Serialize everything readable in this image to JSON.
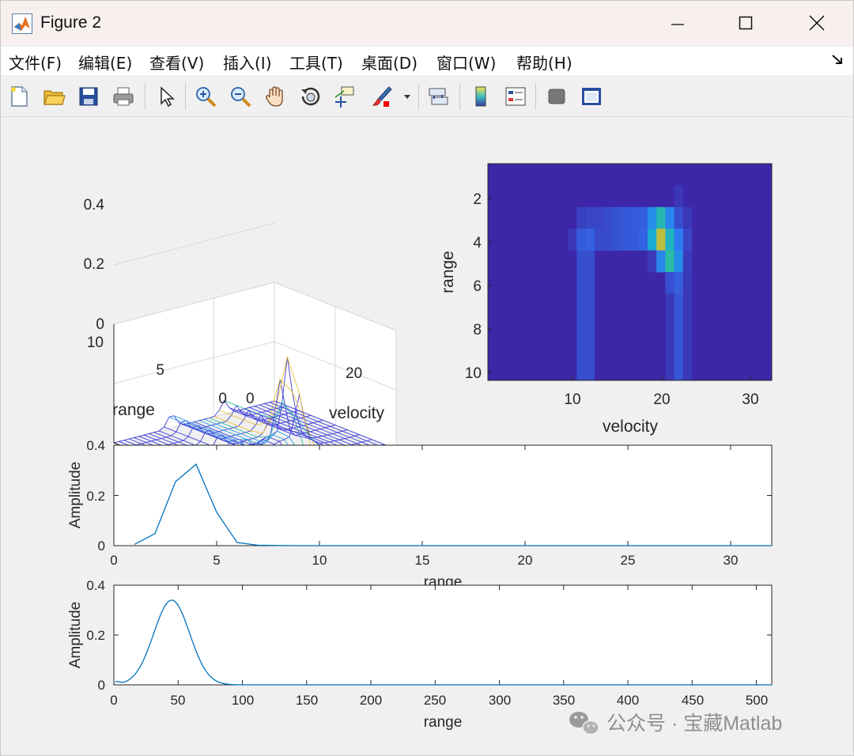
{
  "window": {
    "title": "Figure 2"
  },
  "menu": [
    "文件(F)",
    "编辑(E)",
    "查看(V)",
    "插入(I)",
    "工具(T)",
    "桌面(D)",
    "窗口(W)",
    "帮助(H)"
  ],
  "toolbar_icons": [
    "new-figure-icon",
    "open-file-icon",
    "save-icon",
    "print-icon",
    "pointer-icon",
    "zoom-in-icon",
    "zoom-out-icon",
    "pan-icon",
    "rotate-3d-icon",
    "data-cursor-icon",
    "brush-icon",
    "brush-dropdown-icon",
    "link-plot-icon",
    "colorbar-icon",
    "legend-icon",
    "hide-plot-tools-icon",
    "show-plot-tools-icon"
  ],
  "watermark": "公众号 · 宝藏Matlab",
  "chart_data": [
    {
      "type": "surface",
      "xlabel": "velocity",
      "ylabel": "range",
      "x_ticks": [
        "0",
        "20"
      ],
      "y_ticks": [
        "0",
        "5",
        "10"
      ],
      "z_ticks": [
        "0",
        "0.2",
        "0.4"
      ],
      "xlim": [
        0,
        32
      ],
      "ylim": [
        0,
        10
      ],
      "zlim": [
        0,
        0.4
      ],
      "peak": {
        "velocity": 20,
        "range": 4,
        "amplitude": 0.29
      },
      "grid": true
    },
    {
      "type": "heatmap",
      "xlabel": "velocity",
      "ylabel": "range",
      "x_ticks": [
        "10",
        "20",
        "30"
      ],
      "y_ticks": [
        "2",
        "4",
        "6",
        "8",
        "10"
      ],
      "xlim": [
        0.5,
        32.5
      ],
      "ylim": [
        0.5,
        10.5
      ],
      "colormap": "parula",
      "bright_cells": [
        [
          20,
          3
        ],
        [
          20,
          4
        ],
        [
          21,
          5
        ],
        [
          19,
          3
        ],
        [
          19,
          4
        ],
        [
          17,
          4
        ],
        [
          16,
          4
        ],
        [
          15,
          4
        ],
        [
          21,
          4
        ],
        [
          22,
          4
        ],
        [
          21,
          6
        ],
        [
          11,
          4
        ],
        [
          12,
          3
        ],
        [
          13,
          3
        ]
      ]
    },
    {
      "type": "line",
      "xlabel": "range",
      "ylabel": "Amplitude",
      "x_ticks": [
        "0",
        "5",
        "10",
        "15",
        "20",
        "25",
        "30"
      ],
      "y_ticks": [
        "0",
        "0.2",
        "0.4"
      ],
      "xlim": [
        0,
        32
      ],
      "ylim": [
        0,
        0.4
      ],
      "x": [
        1,
        2,
        3,
        4,
        5,
        6,
        7,
        8,
        9,
        10,
        11,
        12,
        13,
        14,
        15,
        16,
        17,
        18,
        19,
        20,
        21,
        22,
        23,
        24,
        25,
        26,
        27,
        28,
        29,
        30,
        31,
        32
      ],
      "y": [
        0.005,
        0.048,
        0.255,
        0.324,
        0.133,
        0.012,
        0.002,
        0.0005,
        0,
        0,
        0,
        0,
        0,
        0,
        0,
        0,
        0,
        0,
        0,
        0,
        0,
        0,
        0,
        0,
        0,
        0,
        0,
        0,
        0,
        0,
        0,
        0
      ],
      "color": "#0072bd"
    },
    {
      "type": "line",
      "xlabel": "range",
      "ylabel": "Amplitude",
      "x_ticks": [
        "0",
        "50",
        "100",
        "150",
        "200",
        "250",
        "300",
        "350",
        "400",
        "450",
        "500"
      ],
      "y_ticks": [
        "0",
        "0.2",
        "0.4"
      ],
      "xlim": [
        0,
        512
      ],
      "ylim": [
        0,
        0.4
      ],
      "peak": {
        "x": 45,
        "y": 0.34,
        "width": 14
      },
      "color": "#0072bd"
    }
  ]
}
